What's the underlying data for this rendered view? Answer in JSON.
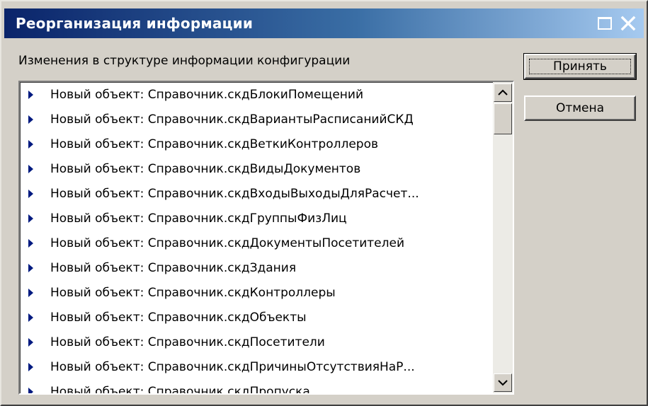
{
  "window": {
    "title": "Реорганизация информации"
  },
  "caption": "Изменения в структуре информации конфигурации",
  "buttons": {
    "ok_label": "Принять",
    "cancel_label": "Отмена"
  },
  "list": {
    "items": [
      {
        "label": "Новый объект: Справочник.скдБлокиПомещений"
      },
      {
        "label": "Новый объект: Справочник.скдВариантыРасписанийСКД"
      },
      {
        "label": "Новый объект: Справочник.скдВеткиКонтроллеров"
      },
      {
        "label": "Новый объект: Справочник.скдВидыДокументов"
      },
      {
        "label": "Новый объект: Справочник.скдВходыВыходыДляРасчет..."
      },
      {
        "label": "Новый объект: Справочник.скдГруппыФизЛиц"
      },
      {
        "label": "Новый объект: Справочник.скдДокументыПосетителей"
      },
      {
        "label": "Новый объект: Справочник.скдЗдания"
      },
      {
        "label": "Новый объект: Справочник.скдКонтроллеры"
      },
      {
        "label": "Новый объект: Справочник.скдОбъекты"
      },
      {
        "label": "Новый объект: Справочник.скдПосетители"
      },
      {
        "label": "Новый объект: Справочник.скдПричиныОтсутствияНаР..."
      },
      {
        "label": "Новый объект: Справочник.скдПропуска"
      }
    ]
  },
  "icons": {
    "maximize": "maximize-icon",
    "close": "close-icon",
    "bullet": "triangle-right-icon",
    "scroll_up": "scroll-up-arrow-icon",
    "scroll_down": "scroll-down-arrow-icon"
  },
  "colors": {
    "titlebar_start": "#0a246a",
    "titlebar_end": "#a6caf0",
    "dialog_face": "#d4d0c8",
    "bullet": "#001a80"
  }
}
